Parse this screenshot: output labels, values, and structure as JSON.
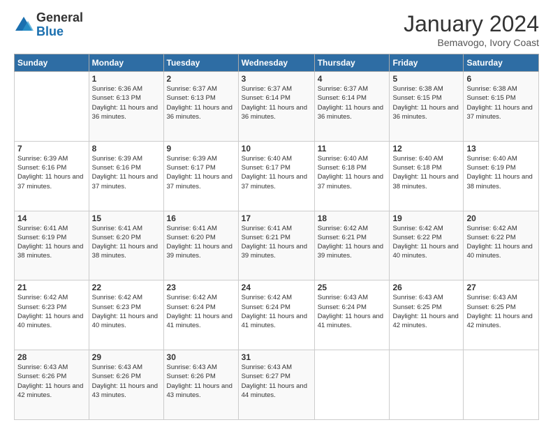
{
  "logo": {
    "general": "General",
    "blue": "Blue"
  },
  "title": "January 2024",
  "subtitle": "Bemavogo, Ivory Coast",
  "days_header": [
    "Sunday",
    "Monday",
    "Tuesday",
    "Wednesday",
    "Thursday",
    "Friday",
    "Saturday"
  ],
  "weeks": [
    [
      {
        "day": "",
        "sunrise": "",
        "sunset": "",
        "daylight": ""
      },
      {
        "day": "1",
        "sunrise": "Sunrise: 6:36 AM",
        "sunset": "Sunset: 6:13 PM",
        "daylight": "Daylight: 11 hours and 36 minutes."
      },
      {
        "day": "2",
        "sunrise": "Sunrise: 6:37 AM",
        "sunset": "Sunset: 6:13 PM",
        "daylight": "Daylight: 11 hours and 36 minutes."
      },
      {
        "day": "3",
        "sunrise": "Sunrise: 6:37 AM",
        "sunset": "Sunset: 6:14 PM",
        "daylight": "Daylight: 11 hours and 36 minutes."
      },
      {
        "day": "4",
        "sunrise": "Sunrise: 6:37 AM",
        "sunset": "Sunset: 6:14 PM",
        "daylight": "Daylight: 11 hours and 36 minutes."
      },
      {
        "day": "5",
        "sunrise": "Sunrise: 6:38 AM",
        "sunset": "Sunset: 6:15 PM",
        "daylight": "Daylight: 11 hours and 36 minutes."
      },
      {
        "day": "6",
        "sunrise": "Sunrise: 6:38 AM",
        "sunset": "Sunset: 6:15 PM",
        "daylight": "Daylight: 11 hours and 37 minutes."
      }
    ],
    [
      {
        "day": "7",
        "sunrise": "Sunrise: 6:39 AM",
        "sunset": "Sunset: 6:16 PM",
        "daylight": "Daylight: 11 hours and 37 minutes."
      },
      {
        "day": "8",
        "sunrise": "Sunrise: 6:39 AM",
        "sunset": "Sunset: 6:16 PM",
        "daylight": "Daylight: 11 hours and 37 minutes."
      },
      {
        "day": "9",
        "sunrise": "Sunrise: 6:39 AM",
        "sunset": "Sunset: 6:17 PM",
        "daylight": "Daylight: 11 hours and 37 minutes."
      },
      {
        "day": "10",
        "sunrise": "Sunrise: 6:40 AM",
        "sunset": "Sunset: 6:17 PM",
        "daylight": "Daylight: 11 hours and 37 minutes."
      },
      {
        "day": "11",
        "sunrise": "Sunrise: 6:40 AM",
        "sunset": "Sunset: 6:18 PM",
        "daylight": "Daylight: 11 hours and 37 minutes."
      },
      {
        "day": "12",
        "sunrise": "Sunrise: 6:40 AM",
        "sunset": "Sunset: 6:18 PM",
        "daylight": "Daylight: 11 hours and 38 minutes."
      },
      {
        "day": "13",
        "sunrise": "Sunrise: 6:40 AM",
        "sunset": "Sunset: 6:19 PM",
        "daylight": "Daylight: 11 hours and 38 minutes."
      }
    ],
    [
      {
        "day": "14",
        "sunrise": "Sunrise: 6:41 AM",
        "sunset": "Sunset: 6:19 PM",
        "daylight": "Daylight: 11 hours and 38 minutes."
      },
      {
        "day": "15",
        "sunrise": "Sunrise: 6:41 AM",
        "sunset": "Sunset: 6:20 PM",
        "daylight": "Daylight: 11 hours and 38 minutes."
      },
      {
        "day": "16",
        "sunrise": "Sunrise: 6:41 AM",
        "sunset": "Sunset: 6:20 PM",
        "daylight": "Daylight: 11 hours and 39 minutes."
      },
      {
        "day": "17",
        "sunrise": "Sunrise: 6:41 AM",
        "sunset": "Sunset: 6:21 PM",
        "daylight": "Daylight: 11 hours and 39 minutes."
      },
      {
        "day": "18",
        "sunrise": "Sunrise: 6:42 AM",
        "sunset": "Sunset: 6:21 PM",
        "daylight": "Daylight: 11 hours and 39 minutes."
      },
      {
        "day": "19",
        "sunrise": "Sunrise: 6:42 AM",
        "sunset": "Sunset: 6:22 PM",
        "daylight": "Daylight: 11 hours and 40 minutes."
      },
      {
        "day": "20",
        "sunrise": "Sunrise: 6:42 AM",
        "sunset": "Sunset: 6:22 PM",
        "daylight": "Daylight: 11 hours and 40 minutes."
      }
    ],
    [
      {
        "day": "21",
        "sunrise": "Sunrise: 6:42 AM",
        "sunset": "Sunset: 6:23 PM",
        "daylight": "Daylight: 11 hours and 40 minutes."
      },
      {
        "day": "22",
        "sunrise": "Sunrise: 6:42 AM",
        "sunset": "Sunset: 6:23 PM",
        "daylight": "Daylight: 11 hours and 40 minutes."
      },
      {
        "day": "23",
        "sunrise": "Sunrise: 6:42 AM",
        "sunset": "Sunset: 6:24 PM",
        "daylight": "Daylight: 11 hours and 41 minutes."
      },
      {
        "day": "24",
        "sunrise": "Sunrise: 6:42 AM",
        "sunset": "Sunset: 6:24 PM",
        "daylight": "Daylight: 11 hours and 41 minutes."
      },
      {
        "day": "25",
        "sunrise": "Sunrise: 6:43 AM",
        "sunset": "Sunset: 6:24 PM",
        "daylight": "Daylight: 11 hours and 41 minutes."
      },
      {
        "day": "26",
        "sunrise": "Sunrise: 6:43 AM",
        "sunset": "Sunset: 6:25 PM",
        "daylight": "Daylight: 11 hours and 42 minutes."
      },
      {
        "day": "27",
        "sunrise": "Sunrise: 6:43 AM",
        "sunset": "Sunset: 6:25 PM",
        "daylight": "Daylight: 11 hours and 42 minutes."
      }
    ],
    [
      {
        "day": "28",
        "sunrise": "Sunrise: 6:43 AM",
        "sunset": "Sunset: 6:26 PM",
        "daylight": "Daylight: 11 hours and 42 minutes."
      },
      {
        "day": "29",
        "sunrise": "Sunrise: 6:43 AM",
        "sunset": "Sunset: 6:26 PM",
        "daylight": "Daylight: 11 hours and 43 minutes."
      },
      {
        "day": "30",
        "sunrise": "Sunrise: 6:43 AM",
        "sunset": "Sunset: 6:26 PM",
        "daylight": "Daylight: 11 hours and 43 minutes."
      },
      {
        "day": "31",
        "sunrise": "Sunrise: 6:43 AM",
        "sunset": "Sunset: 6:27 PM",
        "daylight": "Daylight: 11 hours and 44 minutes."
      },
      {
        "day": "",
        "sunrise": "",
        "sunset": "",
        "daylight": ""
      },
      {
        "day": "",
        "sunrise": "",
        "sunset": "",
        "daylight": ""
      },
      {
        "day": "",
        "sunrise": "",
        "sunset": "",
        "daylight": ""
      }
    ]
  ]
}
